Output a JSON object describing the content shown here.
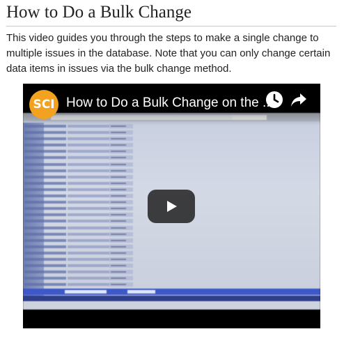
{
  "article": {
    "title": "How to Do a Bulk Change",
    "description": "This video guides you through the steps to make a single change to multiple issues in the database. Note that you can only change certain data items in issues via the bulk change method."
  },
  "video": {
    "title": "How to Do a Bulk Change on the ...",
    "channel_logo_text": "SCI",
    "icons": [
      "clock-icon",
      "share-icon",
      "play-icon"
    ],
    "accent_colors": {
      "logo": "#f3a21f",
      "play_bg": "#212121"
    }
  }
}
